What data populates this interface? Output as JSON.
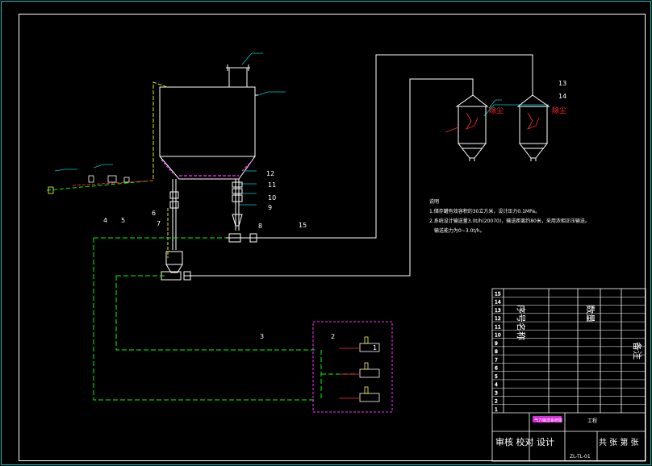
{
  "callouts": [
    "1",
    "2",
    "3",
    "4",
    "5",
    "6",
    "7",
    "8",
    "9",
    "10",
    "11",
    "12",
    "13",
    "14",
    "15"
  ],
  "notes": {
    "heading": "说明",
    "line1": "1.储存罐有效容积约30立方米，设计压力0.1MPa。",
    "line2": "2.系统设计输送量3.0t/h(20070)，输送距离约80米，采用浓相正压输送。",
    "line3": "输送能力为0~3.0t/h。"
  },
  "red_labels": {
    "left_filter": "除尘",
    "right_filter": "除尘"
  },
  "title_block": {
    "row_numbers": [
      "15",
      "14",
      "13",
      "12",
      "11",
      "10",
      "9",
      "8",
      "7",
      "6",
      "5",
      "4",
      "3",
      "2",
      "1"
    ],
    "vertical_text_left": "序号名称",
    "vertical_text_mid": "数量",
    "vertical_text_right": "备注",
    "stamp": "气力输送系统图",
    "stage": "工程",
    "footer_left": "审核 校对 设计",
    "sheet": "共 张 第 张",
    "drawing_no": "ZL-TL-01"
  }
}
